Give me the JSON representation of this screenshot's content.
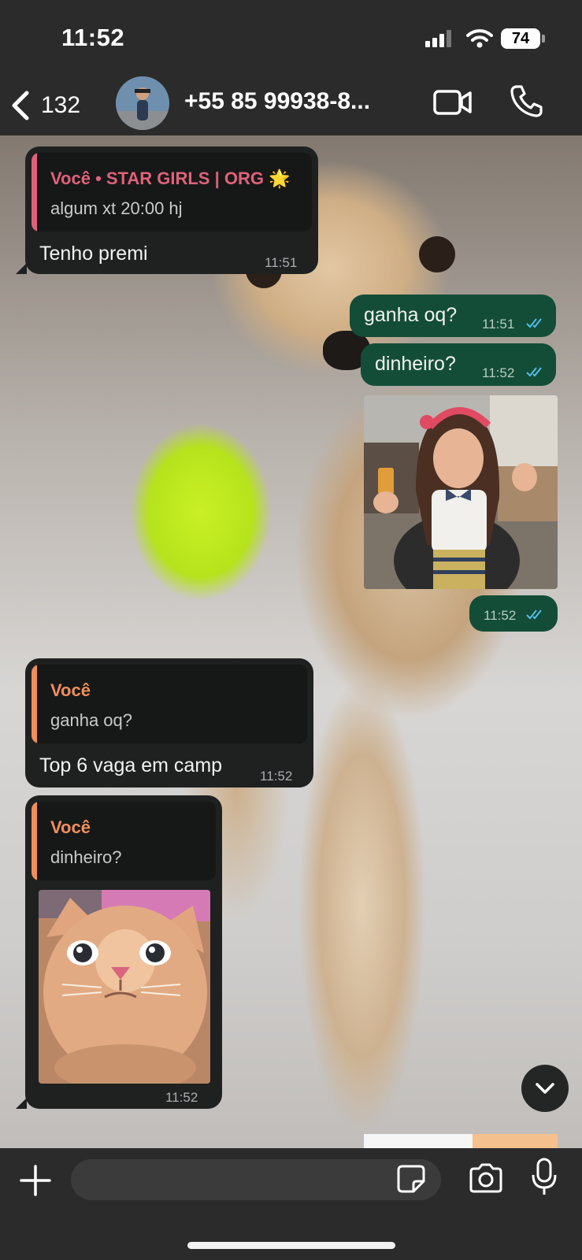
{
  "status_bar": {
    "time": "11:52",
    "battery": "74"
  },
  "header": {
    "back_count": "132",
    "contact_name": "+55 85 99938-8...",
    "avatar_icon": "contact-avatar",
    "video_icon": "video-camera-icon",
    "call_icon": "phone-icon"
  },
  "messages": [
    {
      "direction": "incoming",
      "quote": {
        "author": "Você • STAR GIRLS | ORG 🌟",
        "text": "algum xt 20:00 hj",
        "accent": "#e0627a"
      },
      "text": "Tenho premi",
      "time": "11:51"
    },
    {
      "direction": "outgoing",
      "text": "ganha oq?",
      "time": "11:51",
      "status": "read"
    },
    {
      "direction": "outgoing",
      "text": "dinheiro?",
      "time": "11:52",
      "status": "read"
    },
    {
      "direction": "outgoing",
      "type": "image",
      "image": "photo of a smiling girl in a restaurant holding a glass of juice",
      "time": "11:52",
      "status": "read"
    },
    {
      "direction": "incoming",
      "quote": {
        "author": "Você",
        "text": "ganha oq?",
        "accent": "#f08f5a"
      },
      "text": "Top 6 vaga em camp",
      "time": "11:52"
    },
    {
      "direction": "incoming",
      "quote": {
        "author": "Você",
        "text": "dinheiro?",
        "accent": "#f08f5a"
      },
      "type": "image",
      "image": "close-up photo of an orange kitten",
      "time": "11:52"
    }
  ],
  "composer": {
    "placeholder": "",
    "attach_icon": "plus-icon",
    "sticker_icon": "sticker-icon",
    "camera_icon": "camera-icon",
    "mic_icon": "microphone-icon"
  },
  "colors": {
    "bar_bg": "#2b2b2b",
    "incoming_bubble": "#1f2121",
    "outgoing_bubble": "#134d37",
    "read_ticks": "#53bdeb"
  }
}
